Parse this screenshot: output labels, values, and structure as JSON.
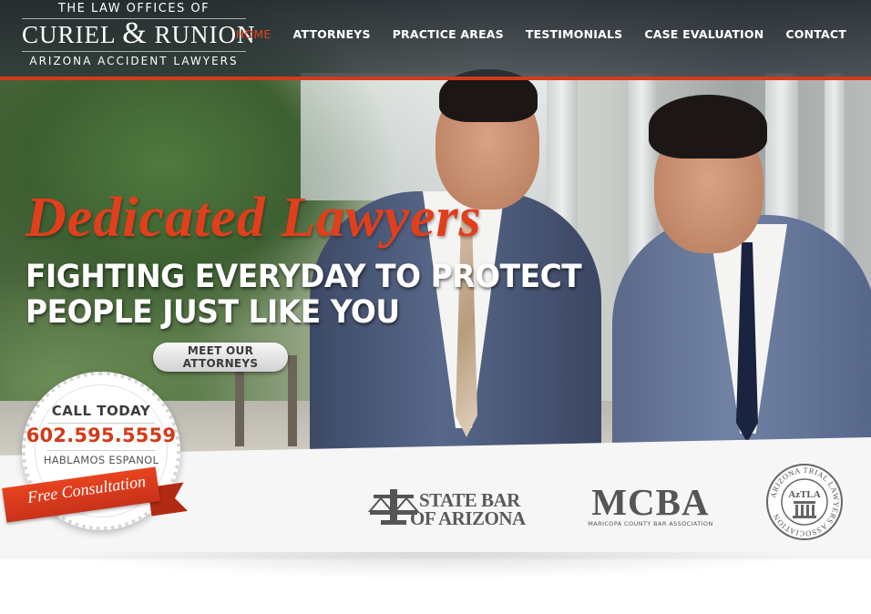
{
  "header": {
    "logo": {
      "line1": "THE LAW OFFICES OF",
      "name_left": "CURIEL",
      "ampersand": "&",
      "name_right": "RUNION",
      "line3": "ARIZONA ACCIDENT LAWYERS"
    },
    "nav": [
      {
        "label": "HOME",
        "active": true
      },
      {
        "label": "ATTORNEYS",
        "active": false
      },
      {
        "label": "PRACTICE AREAS",
        "active": false
      },
      {
        "label": "TESTIMONIALS",
        "active": false
      },
      {
        "label": "CASE EVALUATION",
        "active": false
      },
      {
        "label": "CONTACT",
        "active": false
      }
    ]
  },
  "hero": {
    "headline": "Dedicated Lawyers",
    "tagline_line1": "FIGHTING EVERYDAY TO PROTECT",
    "tagline_line2": "PEOPLE JUST LIKE YOU",
    "cta_label": "MEET OUR ATTORNEYS"
  },
  "seal": {
    "call_today": "CALL TODAY",
    "phone": "602.595.5559",
    "language": "HABLAMOS ESPANOL",
    "ribbon": "Free Consultation"
  },
  "associations": {
    "state_bar": {
      "line1": "STATE BAR",
      "line2": "OF ARIZONA"
    },
    "mcba": {
      "abbr": "MCBA",
      "full": "MARICOPA COUNTY BAR ASSOCIATION"
    },
    "aztla": {
      "abbr": "AzTLA",
      "ring": "ARIZONA TRIAL LAWYERS ASSOCIATION"
    }
  },
  "colors": {
    "accent": "#d13b1a",
    "header_bg": "#2e363c",
    "text_dark": "#3b3b3b"
  }
}
